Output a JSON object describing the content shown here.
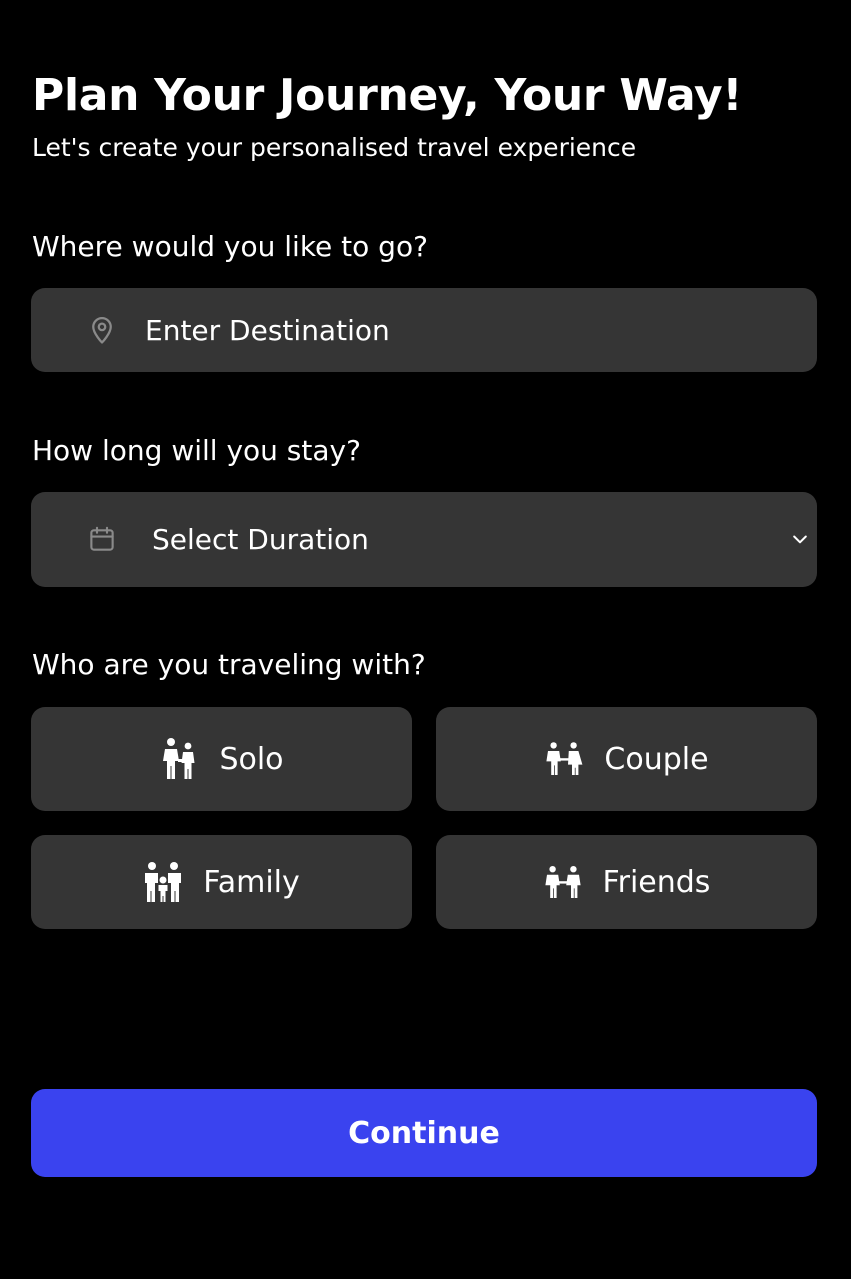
{
  "header": {
    "title": "Plan Your Journey, Your Way!",
    "subtitle": "Let's create your personalised travel experience"
  },
  "destination": {
    "label": "Where would you like to go?",
    "placeholder": "Enter Destination",
    "value": "",
    "icon": "map-pin-icon"
  },
  "duration": {
    "label": "How long will you stay?",
    "selected": "Select Duration",
    "icon": "calendar-icon",
    "dropdown_icon": "chevron-down-icon"
  },
  "companions": {
    "label": "Who are you traveling with?",
    "options": [
      {
        "label": "Solo",
        "icon": "solo-traveler-icon"
      },
      {
        "label": "Couple",
        "icon": "couple-icon"
      },
      {
        "label": "Family",
        "icon": "family-icon"
      },
      {
        "label": "Friends",
        "icon": "friends-icon"
      }
    ]
  },
  "actions": {
    "continue_label": "Continue"
  },
  "colors": {
    "background": "#000000",
    "field_background": "#353535",
    "primary_button": "#3a43ef",
    "icon_muted": "#8a8a8a",
    "text": "#ffffff"
  }
}
